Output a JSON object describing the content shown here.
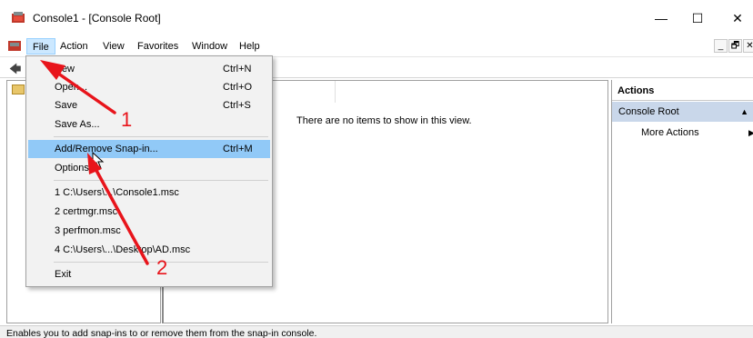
{
  "window": {
    "title": "Console1 - [Console Root]",
    "minimize_glyph": "—",
    "maximize_glyph": "☐",
    "close_glyph": "✕"
  },
  "menubar": {
    "items": [
      "File",
      "Action",
      "View",
      "Favorites",
      "Window",
      "Help"
    ],
    "open_menu": "File",
    "mdi_buttons": [
      "_",
      "🗗",
      "✕"
    ]
  },
  "file_menu": {
    "items": [
      {
        "label": "New",
        "shortcut": "Ctrl+N"
      },
      {
        "label": "Open...",
        "shortcut": "Ctrl+O"
      },
      {
        "label": "Save",
        "shortcut": "Ctrl+S"
      },
      {
        "label": "Save As...",
        "shortcut": ""
      },
      {
        "label": "Add/Remove Snap-in...",
        "shortcut": "Ctrl+M",
        "highlighted": true
      },
      {
        "label": "Options...",
        "shortcut": ""
      },
      {
        "label": "1 C:\\Users\\...\\Console1.msc",
        "shortcut": ""
      },
      {
        "label": "2 certmgr.msc",
        "shortcut": ""
      },
      {
        "label": "3 perfmon.msc",
        "shortcut": ""
      },
      {
        "label": "4 C:\\Users\\...\\Desktop\\AD.msc",
        "shortcut": ""
      },
      {
        "label": "Exit",
        "shortcut": ""
      }
    ]
  },
  "result_pane": {
    "empty_message": "There are no items to show in this view."
  },
  "actions_pane": {
    "header": "Actions",
    "section": "Console Root",
    "more_actions": "More Actions"
  },
  "status_bar": {
    "text": "Enables you to add snap-ins to or remove them from the snap-in console."
  },
  "annotations": {
    "step1": "1",
    "step2": "2",
    "color": "#e8141b"
  },
  "icons": {
    "app": "mmc-console-icon",
    "back": "back-arrow-icon",
    "folder": "folder-icon",
    "cursor": "mouse-pointer-icon"
  }
}
